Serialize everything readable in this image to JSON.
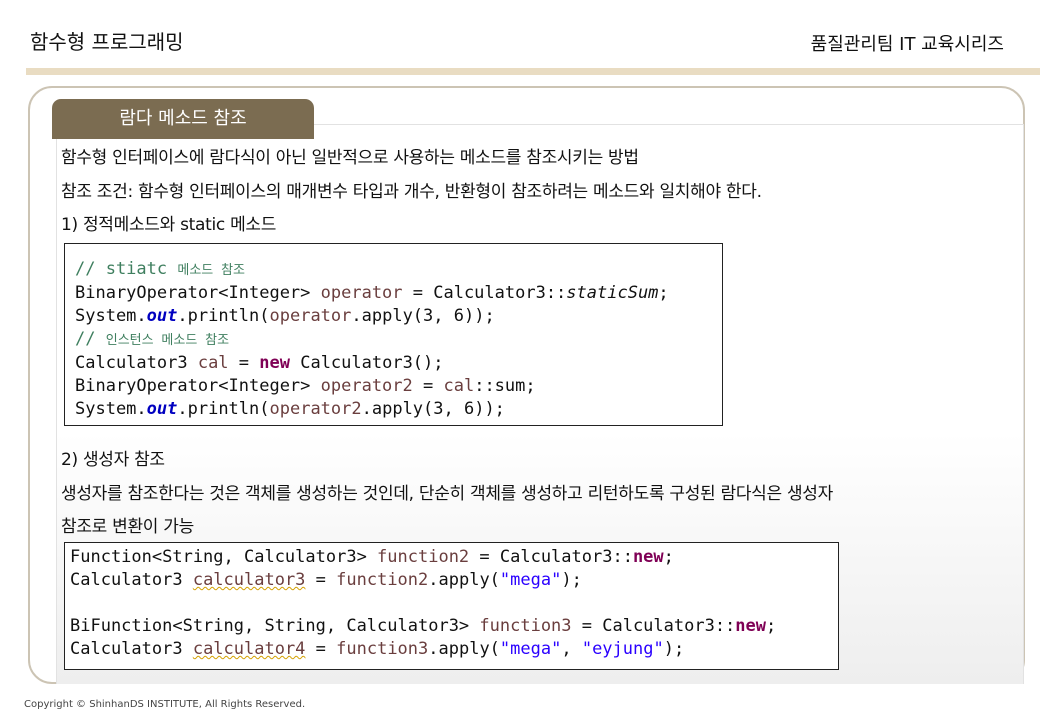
{
  "header": {
    "left_title": "함수형 프로그래밍",
    "right_title": "품질관리팀 IT 교육시리즈"
  },
  "section_tab": "람다 메소드 참조",
  "body": {
    "line1": "함수형 인터페이스에 람다식이 아닌 일반적으로 사용하는 메소드를 참조시키는 방법",
    "line2": "참조 조건: 함수형 인터페이스의 매개변수 타입과 개수, 반환형이 참조하려는 메소드와 일치해야 한다.",
    "line3": "1) 정적메소드와 static 메소드",
    "line4": "2) 생성자 참조",
    "line5": "생성자를 참조한다는 것은 객체를 생성하는 것인데, 단순히 객체를 생성하고 리턴하도록 구성된 람다식은 생성자",
    "line6": "참조로 변환이 가능"
  },
  "code1": {
    "comment1_slashes": "// stiatc",
    "comment1_kr": "메소드 참조",
    "l2_type": "BinaryOperator<Integer> ",
    "l2_var": "operator",
    "l2_assign": " = Calculator3::",
    "l2_method": "staticSum",
    "l2_end": ";",
    "l3_a": "System.",
    "l3_out": "out",
    "l3_b": ".println(",
    "l3_var": "operator",
    "l3_c": ".apply(3, 6));",
    "comment2_slashes": "//",
    "comment2_kr": "인스턴스 메소드 참조",
    "l5_type": "Calculator3 ",
    "l5_var": "cal",
    "l5_eq": " = ",
    "l5_new": "new",
    "l5_end": " Calculator3();",
    "l6_type": "BinaryOperator<Integer> ",
    "l6_var": "operator2",
    "l6_eq": " = ",
    "l6_var2": "cal",
    "l6_end": "::sum;",
    "l7_a": "System.",
    "l7_out": "out",
    "l7_b": ".println(",
    "l7_var": "operator2",
    "l7_c": ".apply(3, 6));"
  },
  "code2": {
    "l1_type": "Function<String, Calculator3> ",
    "l1_var": "function2",
    "l1_mid": " = Calculator3::",
    "l1_new": "new",
    "l1_end": ";",
    "l2_type": "Calculator3 ",
    "l2_var": "calculator3",
    "l2_eq": " = ",
    "l2_var2": "function2",
    "l2_mid": ".apply(",
    "l2_str": "\"mega\"",
    "l2_end": ");",
    "l3_type": "BiFunction<String, String, Calculator3> ",
    "l3_var": "function3",
    "l3_mid": " = Calculator3::",
    "l3_new": "new",
    "l3_end": ";",
    "l4_type": "Calculator3 ",
    "l4_var": "calculator4",
    "l4_eq": " = ",
    "l4_var2": "function3",
    "l4_mid": ".apply(",
    "l4_str1": "\"mega\"",
    "l4_sep": ", ",
    "l4_str2": "\"eyjung\"",
    "l4_end": ");"
  },
  "footer": "Copyright © ShinhanDS INSTITUTE, All Rights Reserved."
}
